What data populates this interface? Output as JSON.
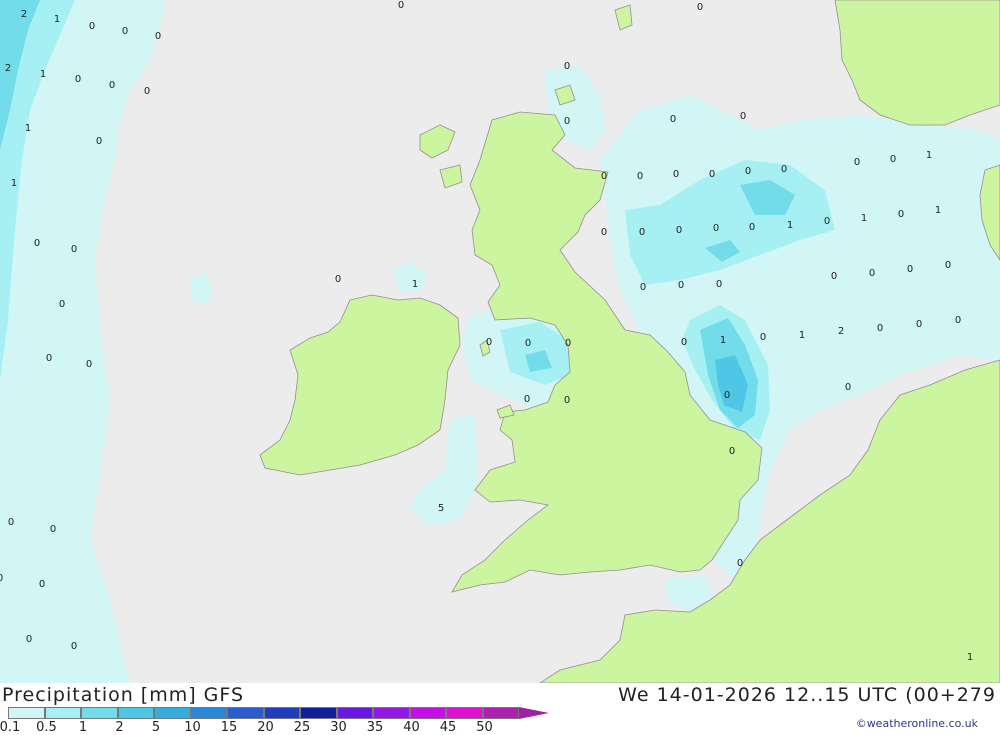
{
  "map": {
    "colors": {
      "sea": "#ececec",
      "land": "#ccf5a0",
      "coast": "#9a8a9a",
      "precip_light": "#d2f6f6",
      "precip_med": "#a6f0f3",
      "precip_high": "#72dcea",
      "precip_heavy": "#4ec6e6"
    },
    "labels": [
      {
        "id": "v01",
        "text": "2"
      },
      {
        "id": "v02",
        "text": "1"
      },
      {
        "id": "v03",
        "text": "0"
      },
      {
        "id": "v04",
        "text": "0"
      },
      {
        "id": "v05",
        "text": "0"
      },
      {
        "id": "v06",
        "text": "0"
      },
      {
        "id": "v07",
        "text": "0"
      },
      {
        "id": "v08",
        "text": "2"
      },
      {
        "id": "v09",
        "text": "1"
      },
      {
        "id": "v10",
        "text": "0"
      },
      {
        "id": "v11",
        "text": "0"
      },
      {
        "id": "v12",
        "text": "0"
      },
      {
        "id": "v13",
        "text": "1"
      },
      {
        "id": "v14",
        "text": "0"
      },
      {
        "id": "v15",
        "text": "1"
      },
      {
        "id": "v16",
        "text": "0"
      },
      {
        "id": "v17",
        "text": "0"
      },
      {
        "id": "v18",
        "text": "0"
      },
      {
        "id": "v19",
        "text": "0"
      },
      {
        "id": "v20",
        "text": "0"
      },
      {
        "id": "v21",
        "text": "0"
      },
      {
        "id": "v22",
        "text": "0"
      },
      {
        "id": "v23",
        "text": "0"
      },
      {
        "id": "v24",
        "text": "0"
      },
      {
        "id": "v25",
        "text": "0"
      },
      {
        "id": "v26",
        "text": "1"
      },
      {
        "id": "v27",
        "text": "0"
      },
      {
        "id": "v28",
        "text": "0"
      },
      {
        "id": "v29",
        "text": "0"
      },
      {
        "id": "v30",
        "text": "0"
      },
      {
        "id": "v31",
        "text": "0"
      },
      {
        "id": "v32",
        "text": "0"
      },
      {
        "id": "v33",
        "text": "0"
      },
      {
        "id": "v34",
        "text": "0"
      },
      {
        "id": "v35",
        "text": "1"
      },
      {
        "id": "v36",
        "text": "0"
      },
      {
        "id": "v37",
        "text": "0"
      },
      {
        "id": "v38",
        "text": "0"
      },
      {
        "id": "v39",
        "text": "0"
      },
      {
        "id": "v40",
        "text": "0"
      },
      {
        "id": "v41",
        "text": "1"
      },
      {
        "id": "v42",
        "text": "0"
      },
      {
        "id": "v43",
        "text": "1"
      },
      {
        "id": "v44",
        "text": "0"
      },
      {
        "id": "v45",
        "text": "1"
      },
      {
        "id": "v46",
        "text": "0"
      },
      {
        "id": "v47",
        "text": "0"
      },
      {
        "id": "v48",
        "text": "0"
      },
      {
        "id": "v49",
        "text": "0"
      },
      {
        "id": "v50",
        "text": "0"
      },
      {
        "id": "v51",
        "text": "0"
      },
      {
        "id": "v52",
        "text": "0"
      },
      {
        "id": "v53",
        "text": "0"
      },
      {
        "id": "v54",
        "text": "0"
      },
      {
        "id": "v55",
        "text": "0"
      },
      {
        "id": "v56",
        "text": "0"
      },
      {
        "id": "v57",
        "text": "1"
      },
      {
        "id": "v58",
        "text": "0"
      },
      {
        "id": "v59",
        "text": "1"
      },
      {
        "id": "v60",
        "text": "2"
      },
      {
        "id": "v61",
        "text": "0"
      },
      {
        "id": "v62",
        "text": "0"
      },
      {
        "id": "v63",
        "text": "0"
      },
      {
        "id": "v64",
        "text": "0"
      },
      {
        "id": "v65",
        "text": "0"
      },
      {
        "id": "v66",
        "text": "0"
      },
      {
        "id": "v67",
        "text": "0"
      },
      {
        "id": "v68",
        "text": "0"
      },
      {
        "id": "v69",
        "text": "5"
      },
      {
        "id": "v70",
        "text": "0"
      },
      {
        "id": "v71",
        "text": "0"
      },
      {
        "id": "v72",
        "text": "0"
      },
      {
        "id": "v73",
        "text": "0"
      },
      {
        "id": "v74",
        "text": "0"
      },
      {
        "id": "v75",
        "text": "0"
      },
      {
        "id": "v76",
        "text": "0"
      },
      {
        "id": "v77",
        "text": "0"
      },
      {
        "id": "v78",
        "text": "1"
      }
    ]
  },
  "footer": {
    "title": "Precipitation [mm] GFS",
    "datetime": "We 14-01-2026 12..15 UTC (00+279",
    "credit": "©weatheronline.co.uk",
    "legend": {
      "ticks": [
        "0.1",
        "0.5",
        "1",
        "2",
        "5",
        "10",
        "15",
        "20",
        "25",
        "30",
        "35",
        "40",
        "45",
        "50"
      ],
      "colors": [
        "#d2f6f6",
        "#a6f0f3",
        "#72dcea",
        "#4ec6e6",
        "#34aee0",
        "#2888d6",
        "#2a5cd0",
        "#1f3cbc",
        "#10209a",
        "#6a1ae0",
        "#9418e6",
        "#c410e6",
        "#e010d2",
        "#b020b0"
      ],
      "arrow_color": "#a020a0"
    }
  }
}
